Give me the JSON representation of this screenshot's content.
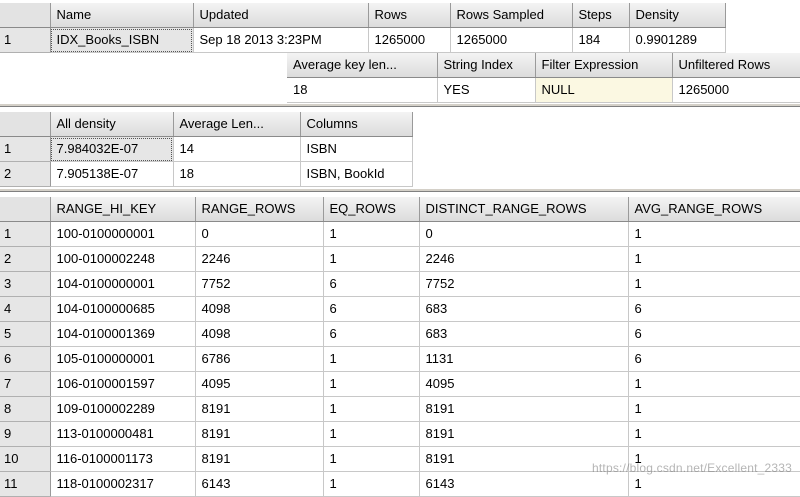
{
  "header": {
    "columns": [
      "Name",
      "Updated",
      "Rows",
      "Rows Sampled",
      "Steps",
      "Density"
    ],
    "rows": [
      {
        "num": "1",
        "cells": [
          "IDX_Books_ISBN",
          "Sep 18 2013  3:23PM",
          "1265000",
          "1265000",
          "184",
          "0.9901289"
        ]
      }
    ],
    "columns2": [
      "Average key len...",
      "String Index",
      "Filter Expression",
      "Unfiltered Rows"
    ],
    "values2": [
      "18",
      "YES",
      "NULL",
      "1265000"
    ]
  },
  "density": {
    "columns": [
      "All density",
      "Average Len...",
      "Columns"
    ],
    "rows": [
      {
        "num": "1",
        "cells": [
          "7.984032E-07",
          "14",
          "ISBN"
        ]
      },
      {
        "num": "2",
        "cells": [
          "7.905138E-07",
          "18",
          "ISBN, BookId"
        ]
      }
    ]
  },
  "histogram": {
    "columns": [
      "RANGE_HI_KEY",
      "RANGE_ROWS",
      "EQ_ROWS",
      "DISTINCT_RANGE_ROWS",
      "AVG_RANGE_ROWS"
    ],
    "rows": [
      {
        "num": "1",
        "cells": [
          "100-0100000001",
          "0",
          "1",
          "0",
          "1"
        ]
      },
      {
        "num": "2",
        "cells": [
          "100-0100002248",
          "2246",
          "1",
          "2246",
          "1"
        ]
      },
      {
        "num": "3",
        "cells": [
          "104-0100000001",
          "7752",
          "6",
          "7752",
          "1"
        ]
      },
      {
        "num": "4",
        "cells": [
          "104-0100000685",
          "4098",
          "6",
          "683",
          "6"
        ]
      },
      {
        "num": "5",
        "cells": [
          "104-0100001369",
          "4098",
          "6",
          "683",
          "6"
        ]
      },
      {
        "num": "6",
        "cells": [
          "105-0100000001",
          "6786",
          "1",
          "1131",
          "6"
        ]
      },
      {
        "num": "7",
        "cells": [
          "106-0100001597",
          "4095",
          "1",
          "4095",
          "1"
        ]
      },
      {
        "num": "8",
        "cells": [
          "109-0100002289",
          "8191",
          "1",
          "8191",
          "1"
        ]
      },
      {
        "num": "9",
        "cells": [
          "113-0100000481",
          "8191",
          "1",
          "8191",
          "1"
        ]
      },
      {
        "num": "10",
        "cells": [
          "116-0100001173",
          "8191",
          "1",
          "8191",
          "1"
        ]
      },
      {
        "num": "11",
        "cells": [
          "118-0100002317",
          "6143",
          "1",
          "6143",
          "1"
        ]
      }
    ]
  },
  "watermark": "https://blog.csdn.net/Excellent_2333"
}
